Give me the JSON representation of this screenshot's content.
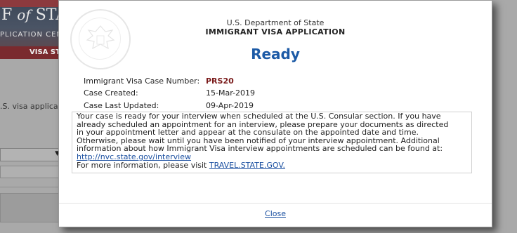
{
  "background": {
    "site_title_prefix": "F",
    "site_title_italic": "of",
    "site_title_suffix": "STAT",
    "site_subtitle": "PLICATION CENT",
    "nav_label": "VISA ST",
    "body_text": ".S. visa applica",
    "select_arrow": "▼"
  },
  "modal": {
    "department": "U.S. Department of State",
    "app_title": "IMMIGRANT VISA APPLICATION",
    "status": "Ready",
    "fields": {
      "case_number_label": "Immigrant Visa Case Number:",
      "case_number_value": "PRS20",
      "created_label": "Case Created:",
      "created_value": "15-Mar-2019",
      "updated_label": "Case Last Updated:",
      "updated_value": "09-Apr-2019"
    },
    "message": {
      "line1": "Your case is ready for your interview when scheduled at the U.S. Consular section. If you have",
      "line2": "already scheduled an appointment for an interview, please prepare your documents as directed",
      "line3": "in your appointment letter and appear at the consulate on the appointed date and time.",
      "line4": "Otherwise, please wait until you have been notified of your interview appointment. Additional",
      "line5": "information about how Immigrant Visa interview appointments are scheduled can be found at:",
      "link_url_text": "http://nvc.state.gov/interview",
      "more_info_prefix": "For more information, please visit ",
      "more_info_link": "TRAVEL.STATE.GOV."
    },
    "close_label": "Close",
    "seal_icon": "state-department-seal-icon"
  },
  "colors": {
    "status": "#1c5aa6",
    "case_number": "#7a1a1a",
    "link": "#1a4fa0"
  }
}
